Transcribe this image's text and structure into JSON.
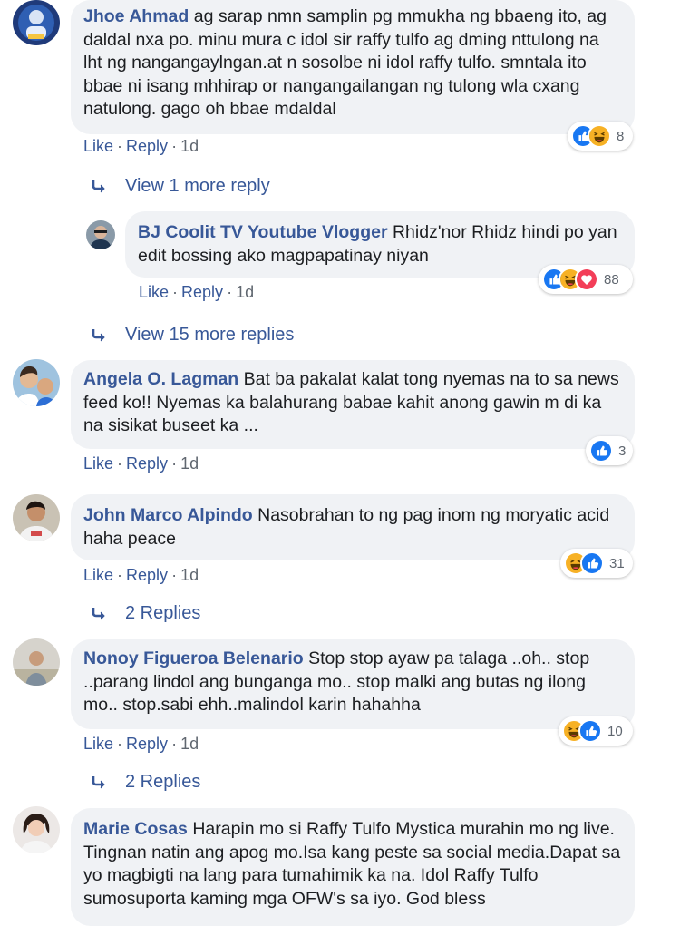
{
  "comments": [
    {
      "author": "Jhoe Ahmad",
      "text": "ag sarap nmn samplin pg mmukha ng bbaeng ito, ag daldal nxa po. minu mura c idol sir raffy tulfo ag dming nttulong na lht ng nangangaylngan.at n sosolbe ni idol raffy tulfo. smntala ito bbae ni isang mhhirap or nangangailangan ng tulong wla cxang natulong. gago oh bbae mdaldal",
      "like": "Like",
      "reply": "Reply",
      "time": "1d",
      "reaction_count": "8",
      "reactions": [
        "like-reaction-icon",
        "haha-reaction-icon"
      ]
    },
    {
      "author": "BJ Coolit TV Youtube Vlogger",
      "text": "Rhidz'nor Rhidz hindi po yan edit bossing ako magpapatinay niyan",
      "like": "Like",
      "reply": "Reply",
      "time": "1d",
      "reaction_count": "88",
      "reactions": [
        "like-reaction-icon",
        "haha-reaction-icon",
        "love-reaction-icon"
      ]
    },
    {
      "author": "Angela O. Lagman",
      "text": "Bat ba pakalat kalat tong nyemas na to sa news feed ko!! Nyemas ka balahurang babae kahit anong gawin m di ka na sisikat buseet ka ...",
      "like": "Like",
      "reply": "Reply",
      "time": "1d",
      "reaction_count": "3",
      "reactions": [
        "like-reaction-icon"
      ]
    },
    {
      "author": "John Marco Alpindo",
      "text": "Nasobrahan to ng pag inom ng moryatic acid haha peace",
      "like": "Like",
      "reply": "Reply",
      "time": "1d",
      "reaction_count": "31",
      "reactions": [
        "haha-reaction-icon",
        "like-reaction-icon"
      ]
    },
    {
      "author": "Nonoy Figueroa Belenario",
      "text": "Stop stop ayaw pa talaga ..oh.. stop ..parang lindol ang bunganga mo.. stop malki ang butas ng ilong mo.. stop.sabi ehh..malindol karin hahahha",
      "like": "Like",
      "reply": "Reply",
      "time": "1d",
      "reaction_count": "10",
      "reactions": [
        "haha-reaction-icon",
        "like-reaction-icon"
      ]
    },
    {
      "author": "Marie Cosas",
      "text": "Harapin mo si Raffy Tulfo Mystica murahin mo ng live. Tingnan natin ang apog mo.Isa kang peste sa social media.Dapat sa yo magbigti na lang para tumahimik ka na. Idol Raffy Tulfo sumosuporta kaming mga OFW's sa iyo. God bless"
    }
  ],
  "reply_links": {
    "view_1_more": "View 1 more reply",
    "view_15_more": "View 15 more replies",
    "two_replies_a": "2 Replies",
    "two_replies_b": "2 Replies"
  },
  "colors": {
    "link": "#385898",
    "meta": "#606770",
    "bubble": "#f0f2f5",
    "like_blue": "#1877f2",
    "haha_yellow": "#f7b125",
    "love_red": "#f33e58"
  }
}
